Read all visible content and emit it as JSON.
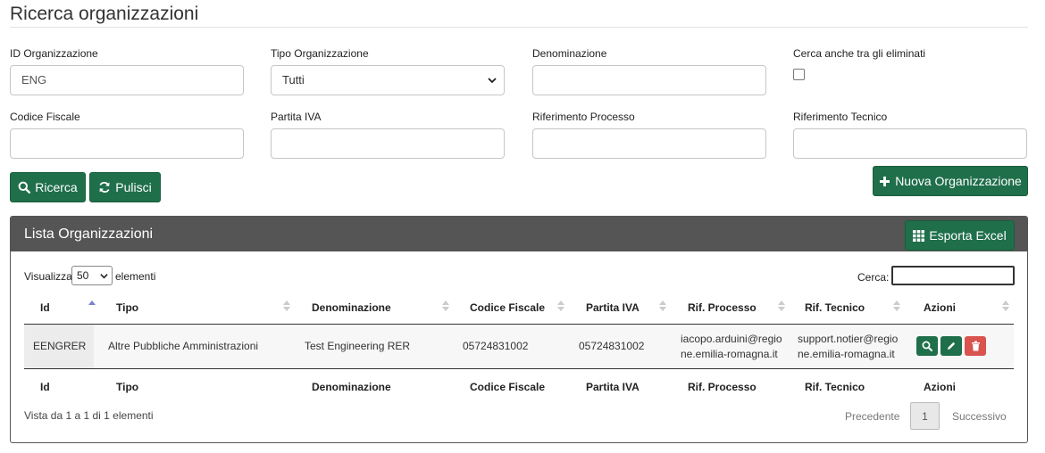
{
  "page": {
    "title": "Ricerca organizzazioni"
  },
  "form": {
    "id_org": {
      "label": "ID Organizzazione",
      "value": "ENG"
    },
    "tipo_org": {
      "label": "Tipo Organizzazione",
      "value": "Tutti"
    },
    "denominazione": {
      "label": "Denominazione",
      "value": ""
    },
    "eliminati": {
      "label": "Cerca anche tra gli eliminati",
      "checked": false
    },
    "codice_fiscale": {
      "label": "Codice Fiscale",
      "value": ""
    },
    "partita_iva": {
      "label": "Partita IVA",
      "value": ""
    },
    "rif_processo": {
      "label": "Riferimento Processo",
      "value": ""
    },
    "rif_tecnico": {
      "label": "Riferimento Tecnico",
      "value": ""
    }
  },
  "buttons": {
    "ricerca": "Ricerca",
    "pulisci": "Pulisci",
    "nuova": "Nuova Organizzazione",
    "esporta": "Esporta Excel"
  },
  "panel": {
    "title": "Lista Organizzazioni",
    "visualizza": "Visualizza",
    "page_length": "50",
    "elementi": "elementi",
    "cerca_label": "Cerca:"
  },
  "table": {
    "columns": [
      "Id",
      "Tipo",
      "Denominazione",
      "Codice Fiscale",
      "Partita IVA",
      "Rif. Processo",
      "Rif. Tecnico",
      "Azioni"
    ],
    "rows": [
      {
        "id": "EENGRER",
        "tipo": "Altre Pubbliche Amministrazioni",
        "denominazione": "Test Engineering RER",
        "codice_fiscale": "05724831002",
        "partita_iva": "05724831002",
        "rif_processo_1": "iacopo.arduini@regio",
        "rif_processo_2": "ne.emilia-romagna.it",
        "rif_tecnico_1": "support.notier@regio",
        "rif_tecnico_2": "ne.emilia-romagna.it"
      }
    ]
  },
  "footer": {
    "info": "Vista da 1 a 1 di 1 elementi",
    "prev": "Precedente",
    "current_page": "1",
    "next": "Successivo"
  },
  "colors": {
    "primary_green": "#1f6f4a",
    "danger_red": "#d9534f",
    "panel_header": "#555555"
  }
}
